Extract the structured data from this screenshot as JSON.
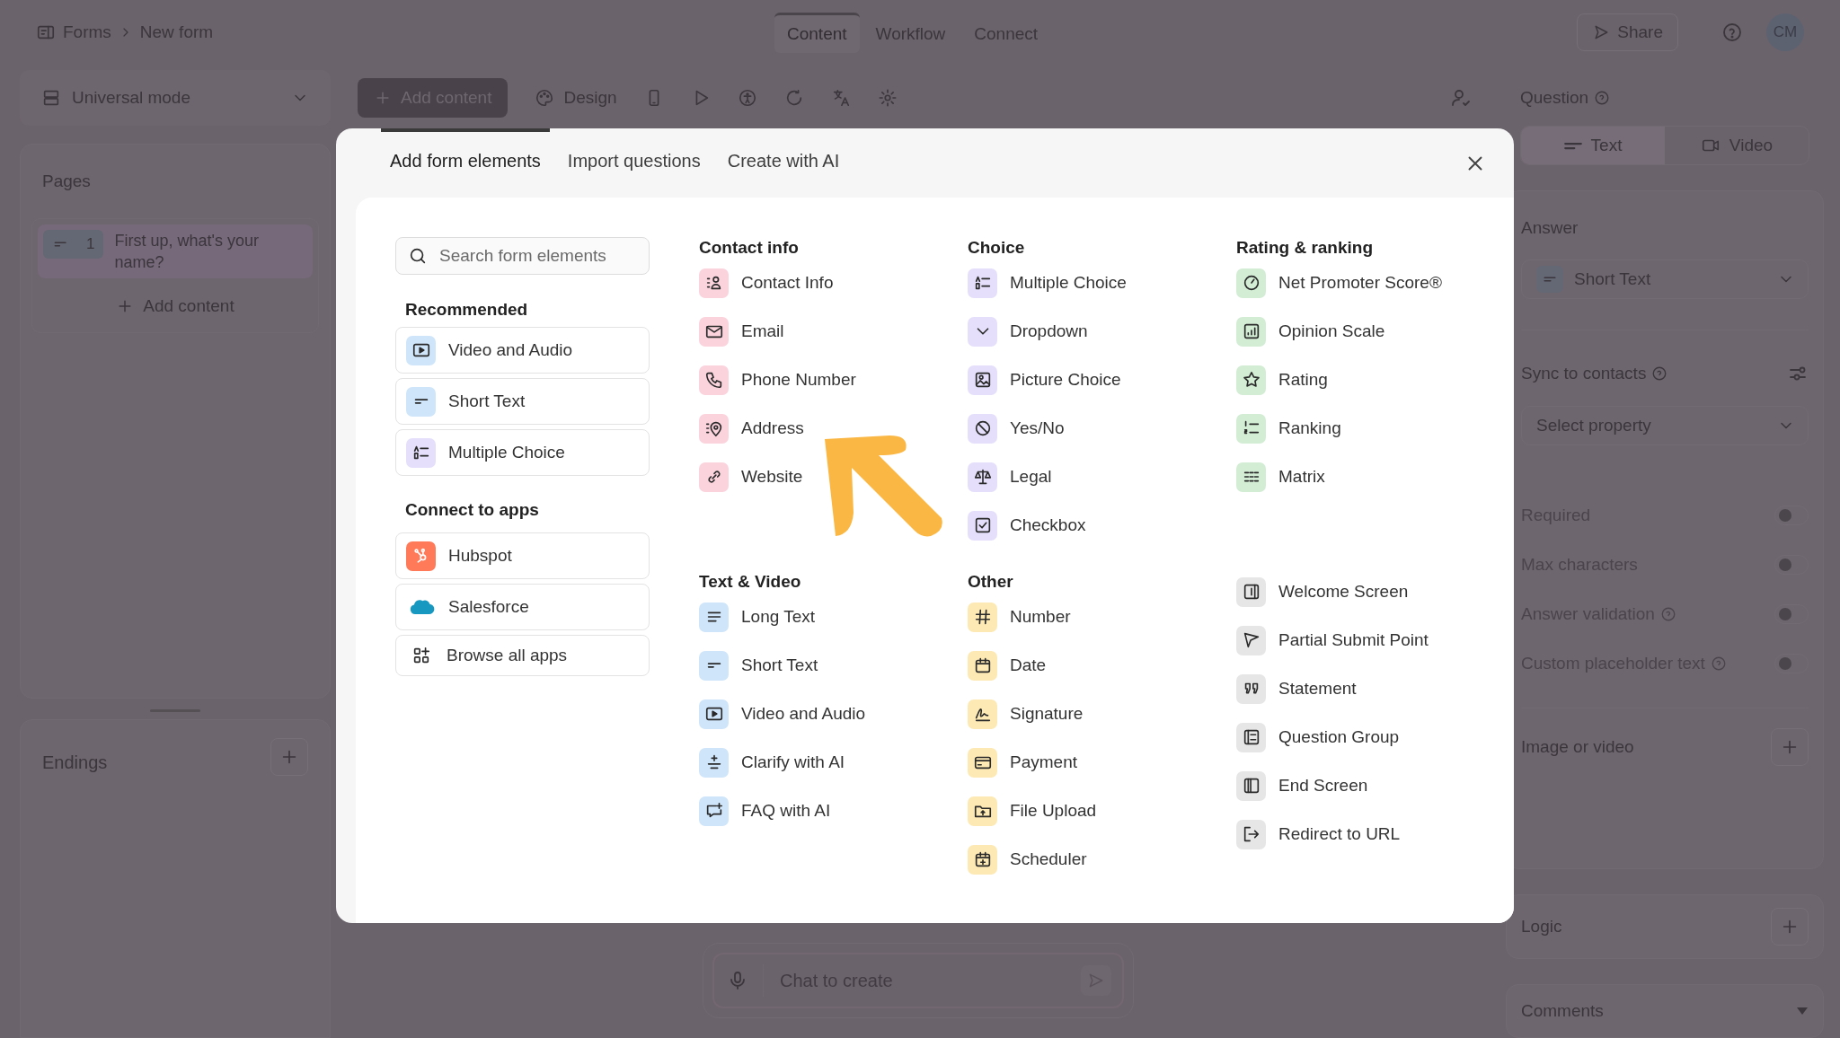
{
  "topbar": {
    "breadcrumb": [
      {
        "label": "Forms"
      },
      {
        "label": "New form"
      }
    ],
    "tabs": [
      {
        "label": "Content",
        "selected": true
      },
      {
        "label": "Workflow",
        "selected": false
      },
      {
        "label": "Connect",
        "selected": false
      }
    ],
    "share": "Share",
    "avatar": "CM"
  },
  "toolbar": {
    "mode": "Universal mode",
    "add_content": "Add content",
    "design": "Design"
  },
  "pages_panel": {
    "title": "Pages",
    "pages": [
      {
        "number": "1",
        "title": "First up, what's your name?",
        "selected": true
      }
    ],
    "add_content": "Add content"
  },
  "endings_panel": {
    "title": "Endings"
  },
  "settings_panel": {
    "question_title": "Question",
    "question_types": [
      {
        "label": "Text",
        "kind": "text",
        "selected": true
      },
      {
        "label": "Video",
        "kind": "video",
        "selected": false
      }
    ],
    "answer_title": "Answer",
    "answer_type": "Short Text",
    "sync_title": "Sync to contacts",
    "sync_placeholder": "Select property",
    "toggles": [
      {
        "label": "Required",
        "help": false,
        "on": false
      },
      {
        "label": "Max characters",
        "help": false,
        "on": false
      },
      {
        "label": "Answer validation",
        "help": true,
        "on": false
      },
      {
        "label": "Custom placeholder text",
        "help": true,
        "on": false
      }
    ],
    "image_title": "Image or video",
    "logic_title": "Logic",
    "comments_title": "Comments"
  },
  "chat": {
    "placeholder": "Chat to create"
  },
  "modal": {
    "tabs": [
      {
        "label": "Add form elements",
        "selected": true
      },
      {
        "label": "Import questions",
        "selected": false
      },
      {
        "label": "Create with AI",
        "selected": false
      }
    ],
    "search_placeholder": "Search form elements",
    "recommended_title": "Recommended",
    "recommended": [
      {
        "label": "Video and Audio",
        "kind": "video",
        "color": "#cfe5fa"
      },
      {
        "label": "Short Text",
        "kind": "short-text",
        "color": "#cfe5fa"
      },
      {
        "label": "Multiple Choice",
        "kind": "multiple-choice",
        "color": "#e5dffb"
      }
    ],
    "apps_title": "Connect to apps",
    "apps": [
      {
        "label": "Hubspot",
        "kind": "hubspot"
      },
      {
        "label": "Salesforce",
        "kind": "salesforce"
      },
      {
        "label": "Browse all apps",
        "kind": "browse"
      }
    ],
    "columns": [
      [
        {
          "title": "Contact info",
          "color": "#fbd3dd",
          "items": [
            {
              "label": "Contact Info",
              "kind": "contact"
            },
            {
              "label": "Email",
              "kind": "email"
            },
            {
              "label": "Phone Number",
              "kind": "phone"
            },
            {
              "label": "Address",
              "kind": "address"
            },
            {
              "label": "Website",
              "kind": "website"
            }
          ]
        },
        {
          "title": "Text & Video",
          "color": "#cfe5fa",
          "items": [
            {
              "label": "Long Text",
              "kind": "long-text"
            },
            {
              "label": "Short Text",
              "kind": "short-text"
            },
            {
              "label": "Video and Audio",
              "kind": "video"
            },
            {
              "label": "Clarify with AI",
              "kind": "clarify"
            },
            {
              "label": "FAQ with AI",
              "kind": "faq"
            }
          ]
        }
      ],
      [
        {
          "title": "Choice",
          "color": "#e5dffb",
          "items": [
            {
              "label": "Multiple Choice",
              "kind": "multiple-choice"
            },
            {
              "label": "Dropdown",
              "kind": "dropdown"
            },
            {
              "label": "Picture Choice",
              "kind": "picture"
            },
            {
              "label": "Yes/No",
              "kind": "yesno"
            },
            {
              "label": "Legal",
              "kind": "legal"
            },
            {
              "label": "Checkbox",
              "kind": "checkbox"
            }
          ]
        },
        {
          "title": "Other",
          "color": "#fde9b4",
          "items": [
            {
              "label": "Number",
              "kind": "number"
            },
            {
              "label": "Date",
              "kind": "date"
            },
            {
              "label": "Signature",
              "kind": "signature"
            },
            {
              "label": "Payment",
              "kind": "payment"
            },
            {
              "label": "File Upload",
              "kind": "upload"
            },
            {
              "label": "Scheduler",
              "kind": "scheduler"
            }
          ]
        }
      ],
      [
        {
          "title": "Rating & ranking",
          "color": "#d3edd5",
          "items": [
            {
              "label": "Net Promoter Score®",
              "kind": "nps"
            },
            {
              "label": "Opinion Scale",
              "kind": "opinion"
            },
            {
              "label": "Rating",
              "kind": "rating"
            },
            {
              "label": "Ranking",
              "kind": "ranking"
            },
            {
              "label": "Matrix",
              "kind": "matrix"
            }
          ]
        },
        {
          "color": "#e6e6e6",
          "items": [
            {
              "label": "Welcome Screen",
              "kind": "welcome"
            },
            {
              "label": "Partial Submit Point",
              "kind": "partial"
            },
            {
              "label": "Statement",
              "kind": "statement"
            },
            {
              "label": "Question Group",
              "kind": "group"
            },
            {
              "label": "End Screen",
              "kind": "end-screen"
            },
            {
              "label": "Redirect to URL",
              "kind": "redirect"
            }
          ]
        }
      ]
    ]
  }
}
